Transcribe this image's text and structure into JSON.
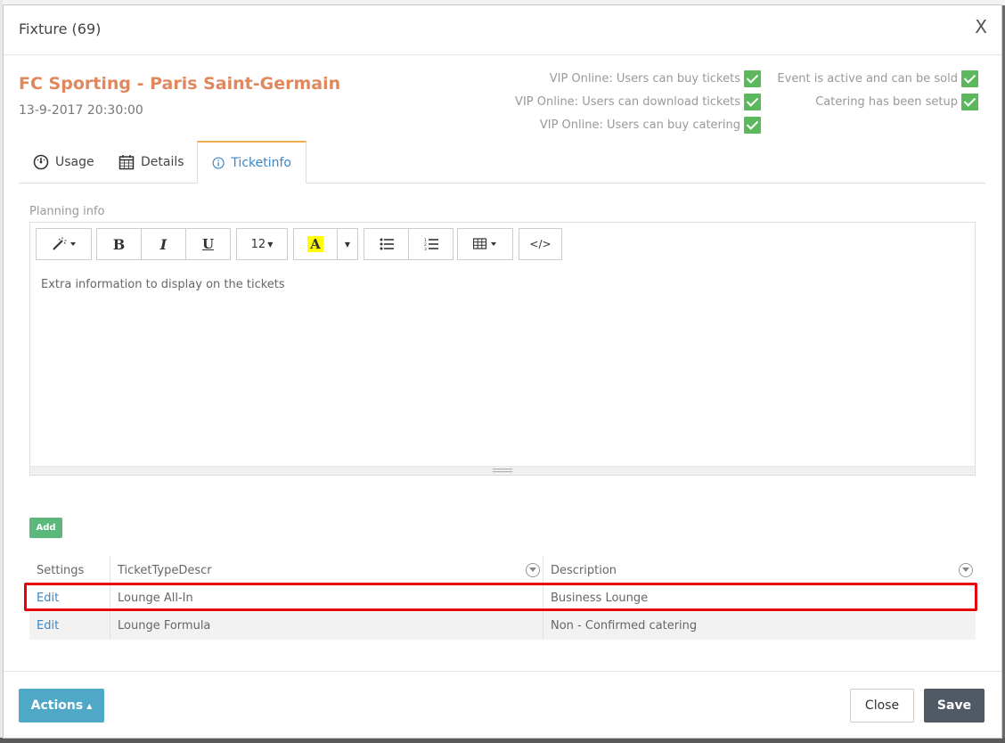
{
  "dialog": {
    "title": "Fixture (69)",
    "close_glyph": "X"
  },
  "event": {
    "name": "FC Sporting - Paris Saint-Germain",
    "datetime": "13-9-2017 20:30:00"
  },
  "status": {
    "vip_buy_tickets": "VIP Online: Users can buy tickets",
    "vip_download_tickets": "VIP Online: Users can download tickets",
    "vip_buy_catering": "VIP Online: Users can buy catering",
    "event_active": "Event is active and can be sold",
    "catering_setup": "Catering has been setup",
    "check_color": "#5cb85c"
  },
  "tabs": [
    {
      "label": "Usage",
      "icon": "gauge-icon"
    },
    {
      "label": "Details",
      "icon": "calendar-icon"
    },
    {
      "label": "Ticketinfo",
      "icon": "info-icon",
      "active": true
    }
  ],
  "editor": {
    "label": "Planning info",
    "content": "Extra information to display on the tickets",
    "font_size": "12",
    "toolbar_icons": [
      "magic-wand-icon",
      "bold-icon",
      "italic-icon",
      "underline-icon",
      "font-size-dropdown",
      "text-color-icon",
      "unordered-list-icon",
      "ordered-list-icon",
      "table-icon",
      "code-view-icon"
    ]
  },
  "add_label": "Add",
  "grid": {
    "columns": [
      "Settings",
      "TicketTypeDescr",
      "Description"
    ],
    "rows": [
      {
        "settings": "Edit",
        "type": "Lounge All-In",
        "description": "Business Lounge"
      },
      {
        "settings": "Edit",
        "type": "Lounge Formula",
        "description": "Non - Confirmed catering"
      }
    ]
  },
  "footer": {
    "actions_label": "Actions",
    "close_label": "Close",
    "save_label": "Save"
  },
  "colors": {
    "accent_title": "#e0875e",
    "link": "#3a87c8",
    "add": "#5cb87a",
    "actions": "#4fa8c6",
    "save": "#505a64",
    "highlight": "#e8000b"
  }
}
